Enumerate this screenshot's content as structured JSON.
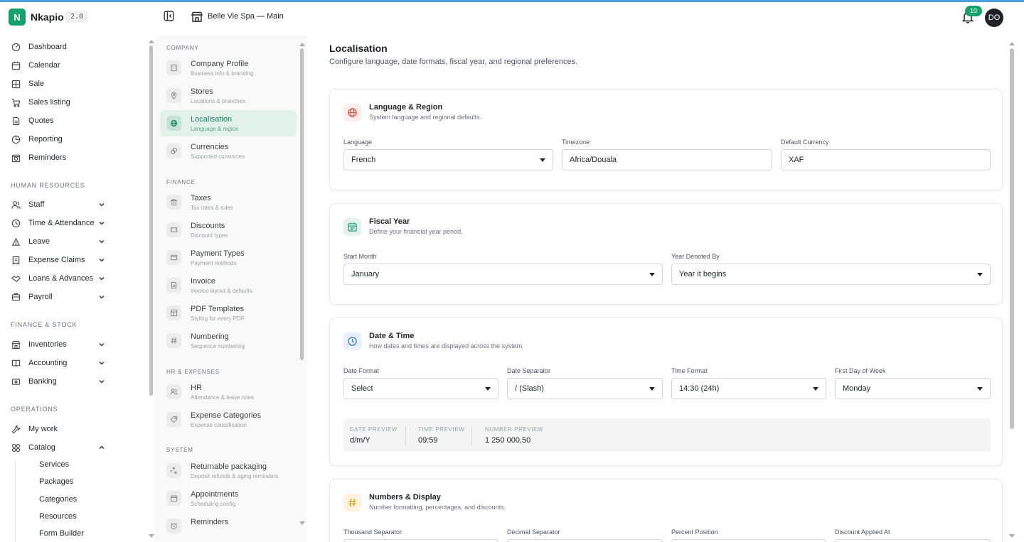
{
  "header": {
    "logo_letter": "N",
    "brand": "Nkapio",
    "version": "2.0",
    "store_name": "Belle Vie Spa — Main",
    "notification_count": "10",
    "avatar_initials": "DO"
  },
  "nav": {
    "main": [
      {
        "label": "Dashboard",
        "icon": "dashboard-icon"
      },
      {
        "label": "Calendar",
        "icon": "calendar-icon"
      },
      {
        "label": "Sale",
        "icon": "sale-icon"
      },
      {
        "label": "Sales listing",
        "icon": "cart-icon"
      },
      {
        "label": "Quotes",
        "icon": "quote-icon"
      },
      {
        "label": "Reporting",
        "icon": "chart-icon"
      },
      {
        "label": "Reminders",
        "icon": "reminder-icon"
      }
    ],
    "hr_section": "HUMAN RESOURCES",
    "hr": [
      {
        "label": "Staff"
      },
      {
        "label": "Time & Attendance"
      },
      {
        "label": "Leave"
      },
      {
        "label": "Expense Claims"
      },
      {
        "label": "Loans & Advances"
      },
      {
        "label": "Payroll"
      }
    ],
    "fs_section": "FINANCE & STOCK",
    "fs": [
      {
        "label": "Inventories"
      },
      {
        "label": "Accounting"
      },
      {
        "label": "Banking"
      }
    ],
    "ops_section": "OPERATIONS",
    "ops": [
      {
        "label": "My work"
      },
      {
        "label": "Catalog"
      }
    ],
    "catalog_sub": [
      "Services",
      "Packages",
      "Categories",
      "Resources",
      "Form Builder"
    ]
  },
  "settings_nav": {
    "company_section": "COMPANY",
    "company": [
      {
        "title": "Company Profile",
        "sub": "Business info & branding"
      },
      {
        "title": "Stores",
        "sub": "Locations & branches"
      },
      {
        "title": "Localisation",
        "sub": "Language & region"
      },
      {
        "title": "Currencies",
        "sub": "Supported currencies"
      }
    ],
    "finance_section": "FINANCE",
    "finance": [
      {
        "title": "Taxes",
        "sub": "Tax rates & rules"
      },
      {
        "title": "Discounts",
        "sub": "Discount types"
      },
      {
        "title": "Payment Types",
        "sub": "Payment methods"
      },
      {
        "title": "Invoice",
        "sub": "Invoice layout & defaults"
      },
      {
        "title": "PDF Templates",
        "sub": "Styling for every PDF"
      },
      {
        "title": "Numbering",
        "sub": "Sequence numbering"
      }
    ],
    "hr_section": "HR & EXPENSES",
    "hr": [
      {
        "title": "HR",
        "sub": "Attendance & leave rules"
      },
      {
        "title": "Expense Categories",
        "sub": "Expense classification"
      }
    ],
    "system_section": "SYSTEM",
    "system": [
      {
        "title": "Returnable packaging",
        "sub": "Deposit refunds & aging reminders"
      },
      {
        "title": "Appointments",
        "sub": "Scheduling config"
      },
      {
        "title": "Reminders",
        "sub": ""
      }
    ]
  },
  "page": {
    "title": "Localisation",
    "description": "Configure language, date formats, fiscal year, and regional preferences."
  },
  "language_region": {
    "title": "Language & Region",
    "subtitle": "System language and regional defaults.",
    "language_label": "Language",
    "language_value": "French",
    "timezone_label": "Timezone",
    "timezone_value": "Africa/Douala",
    "currency_label": "Default Currency",
    "currency_value": "XAF"
  },
  "fiscal_year": {
    "title": "Fiscal Year",
    "subtitle": "Define your financial year period.",
    "start_month_label": "Start Month",
    "start_month_value": "January",
    "denoted_label": "Year Denoted By",
    "denoted_value": "Year it begins"
  },
  "date_time": {
    "title": "Date & Time",
    "subtitle": "How dates and times are displayed across the system.",
    "date_format_label": "Date Format",
    "date_format_value": "Select",
    "date_sep_label": "Date Separator",
    "date_sep_value": "/ (Slash)",
    "time_format_label": "Time Format",
    "time_format_value": "14:30 (24h)",
    "first_day_label": "First Day of Week",
    "first_day_value": "Monday",
    "preview": {
      "date_label": "DATE PREVIEW",
      "date_value": "d/m/Y",
      "time_label": "TIME PREVIEW",
      "time_value": "09:59",
      "number_label": "NUMBER PREVIEW",
      "number_value": "1 250 000,50"
    }
  },
  "numbers_display": {
    "title": "Numbers & Display",
    "subtitle": "Number formatting, percentages, and discounts.",
    "thousand_label": "Thousand Separator",
    "decimal_label": "Decimal Separator",
    "percent_label": "Percent Position",
    "discount_label": "Discount Applied At"
  },
  "colors": {
    "accent": "#16a16d",
    "active_bg": "#e3f1eb",
    "lang_icon": "#e0523a",
    "fiscal_icon": "#16a16d",
    "date_icon": "#2f7bd8",
    "numbers_icon": "#e0a21a"
  }
}
